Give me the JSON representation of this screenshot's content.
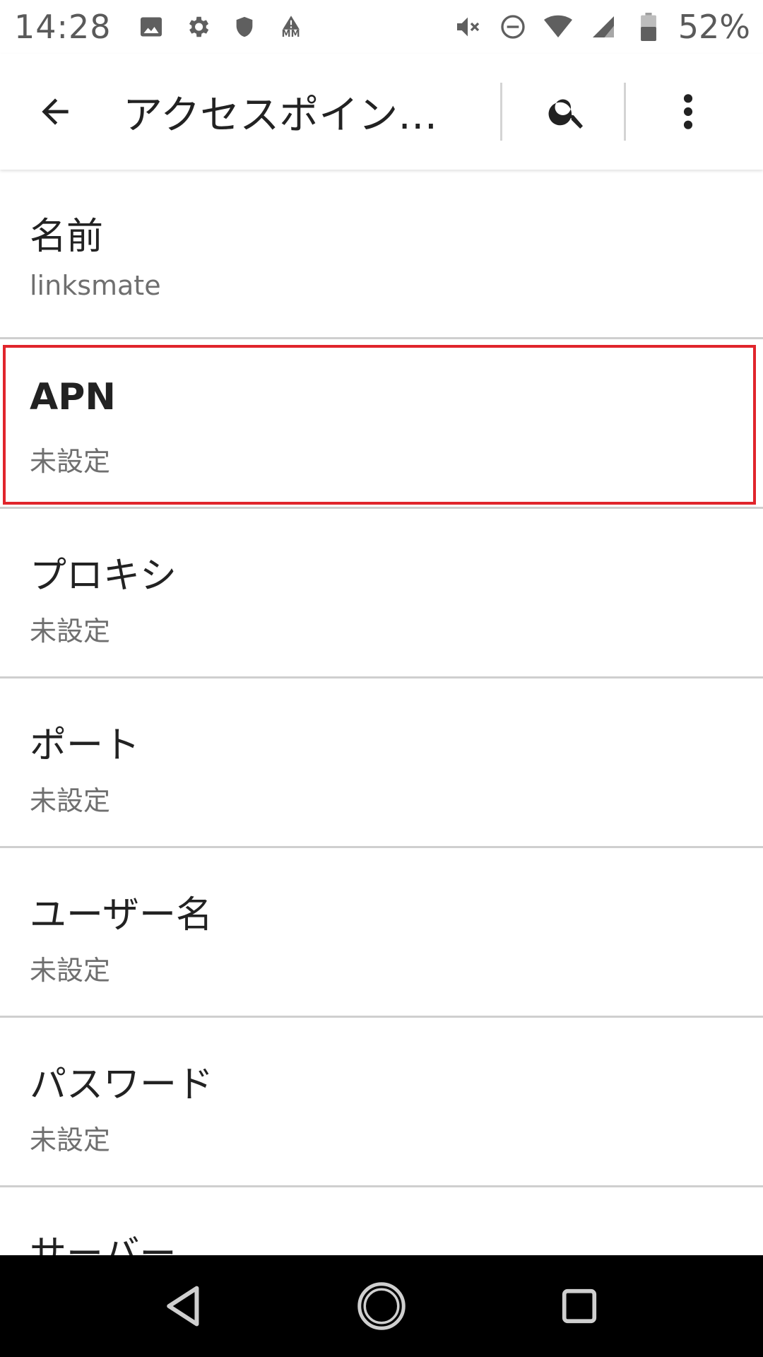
{
  "status_bar": {
    "time": "14:28",
    "left_icons": [
      "image-icon",
      "gear-icon",
      "shield-icon",
      "mm-alert-icon"
    ],
    "mm_label": "MM",
    "right_icons": [
      "mute-icon",
      "do-not-disturb-icon",
      "wifi-icon",
      "cell-signal-icon",
      "battery-icon"
    ],
    "battery_percent": "52%"
  },
  "app_bar": {
    "title": "アクセスポイン…",
    "actions": [
      "search-icon",
      "more-vert-icon"
    ]
  },
  "settings": [
    {
      "title": "名前",
      "value": "linksmate",
      "highlighted": false
    },
    {
      "title": "APN",
      "value": "未設定",
      "highlighted": true
    },
    {
      "title": "プロキシ",
      "value": "未設定",
      "highlighted": false
    },
    {
      "title": "ポート",
      "value": "未設定",
      "highlighted": false
    },
    {
      "title": "ユーザー名",
      "value": "未設定",
      "highlighted": false
    },
    {
      "title": "パスワード",
      "value": "未設定",
      "highlighted": false
    },
    {
      "title": "サーバー",
      "value": "",
      "highlighted": false
    }
  ],
  "colors": {
    "highlight_border": "#e0252c",
    "divider": "#cfcfcf",
    "nav_bar": "#000000"
  },
  "nav_bar": {
    "buttons": [
      "back-triangle-icon",
      "home-circle-icon",
      "recents-square-icon"
    ]
  }
}
